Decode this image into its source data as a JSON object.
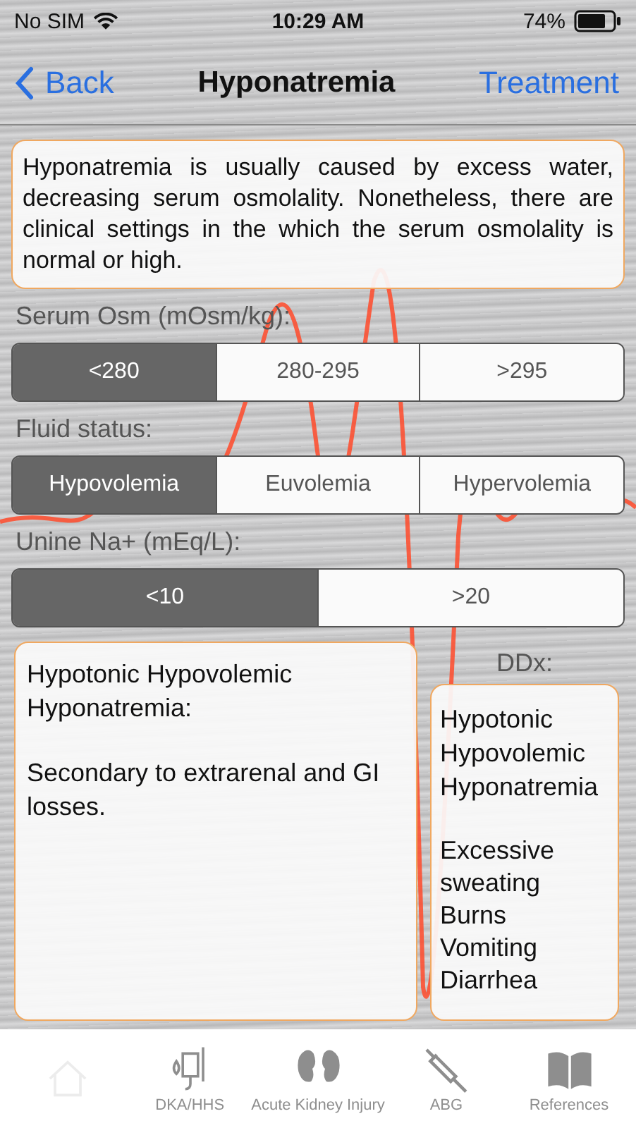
{
  "status_bar": {
    "carrier": "No SIM",
    "time": "10:29 AM",
    "battery": "74%"
  },
  "nav": {
    "back": "Back",
    "title": "Hyponatremia",
    "action": "Treatment"
  },
  "intro": "Hyponatremia is usually caused by excess water, decreasing serum osmolality. Nonetheless, there are clinical settings in the which the serum osmolality is normal or high.",
  "selectors": [
    {
      "label": "Serum Osm (mOsm/kg):",
      "options": [
        {
          "label": "<280",
          "selected": true
        },
        {
          "label": "280-295",
          "selected": false
        },
        {
          "label": ">295",
          "selected": false
        }
      ]
    },
    {
      "label": "Fluid status:",
      "options": [
        {
          "label": "Hypovolemia",
          "selected": true
        },
        {
          "label": "Euvolemia",
          "selected": false
        },
        {
          "label": "Hypervolemia",
          "selected": false
        }
      ]
    },
    {
      "label": "Unine Na+ (mEq/L):",
      "options": [
        {
          "label": "<10",
          "selected": true
        },
        {
          "label": ">20",
          "selected": false
        }
      ]
    }
  ],
  "result": {
    "title": "Hypotonic Hypovolemic Hyponatremia:",
    "text": "Secondary to extrarenal and GI losses."
  },
  "ddx": {
    "label": "DDx:",
    "diagnosis": "Hypotonic Hypovolemic Hyponatremia",
    "causes": [
      "Excessive sweating",
      "Burns",
      "Vomiting",
      "Diarrhea"
    ]
  },
  "tab_bar": [
    {
      "kind": "home",
      "selected": true
    },
    {
      "kind": "iv",
      "label": "DKA/HHS",
      "selected": false
    },
    {
      "kind": "kidney",
      "label": "Acute Kidney Injury",
      "selected": false
    },
    {
      "kind": "syringe",
      "label": "ABG",
      "selected": false
    },
    {
      "kind": "book",
      "label": "References",
      "selected": false
    }
  ]
}
